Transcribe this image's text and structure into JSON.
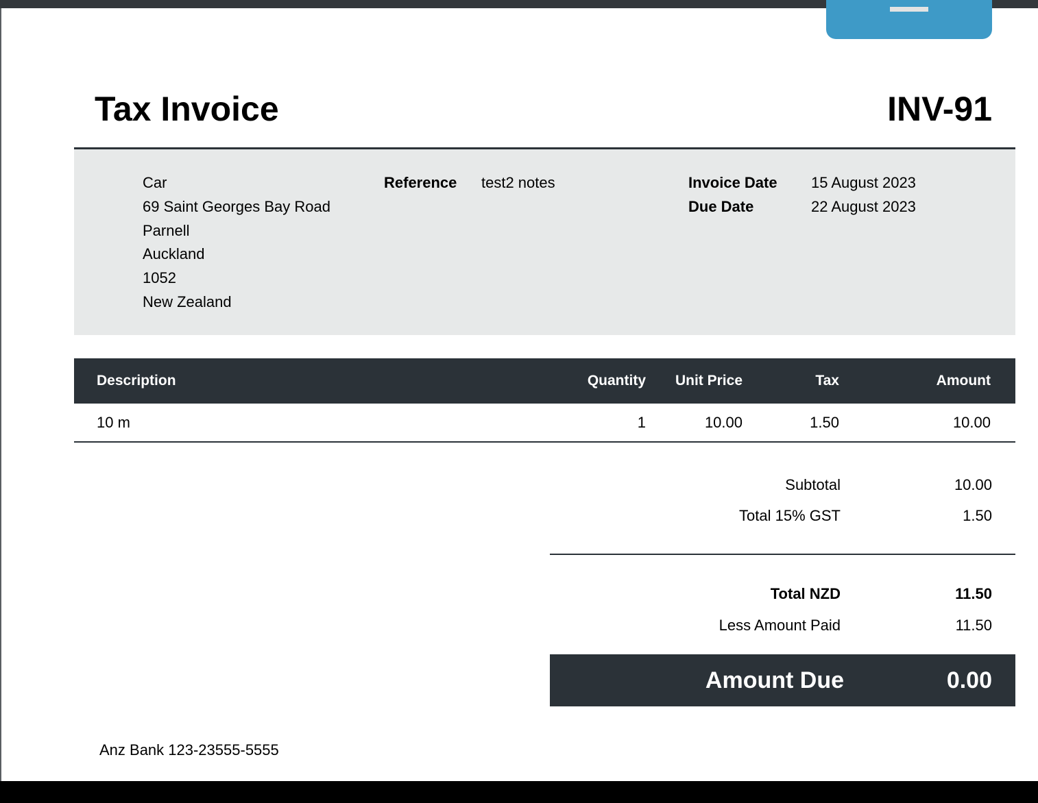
{
  "header": {
    "title": "Tax Invoice",
    "invoice_number": "INV-91"
  },
  "contact": {
    "address_lines": [
      "Car",
      "69 Saint Georges Bay Road",
      "Parnell",
      "Auckland",
      "1052",
      "New Zealand"
    ]
  },
  "reference": {
    "label": "Reference",
    "value": "test2 notes"
  },
  "dates": {
    "invoice_date_label": "Invoice Date",
    "invoice_date_value": "15 August 2023",
    "due_date_label": "Due Date",
    "due_date_value": "22 August 2023"
  },
  "table": {
    "columns": {
      "description": "Description",
      "quantity": "Quantity",
      "unit_price": "Unit Price",
      "tax": "Tax",
      "amount": "Amount"
    },
    "rows": [
      {
        "description": "10 m",
        "quantity": "1",
        "unit_price": "10.00",
        "tax": "1.50",
        "amount": "10.00"
      }
    ]
  },
  "summary": {
    "subtotal_label": "Subtotal",
    "subtotal_value": "10.00",
    "gst_label": "Total 15% GST",
    "gst_value": "1.50",
    "total_label": "Total NZD",
    "total_value": "11.50",
    "paid_label": "Less Amount Paid",
    "paid_value": "11.50",
    "due_label": "Amount Due",
    "due_value": "0.00"
  },
  "footer": {
    "bank": "Anz Bank 123-23555-5555"
  },
  "colors": {
    "dark": "#2b3238",
    "panel": "#e7e9e9",
    "accent": "#3e9ac7"
  }
}
